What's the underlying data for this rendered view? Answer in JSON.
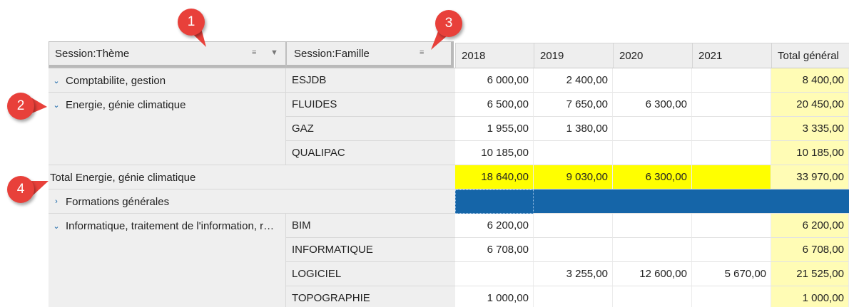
{
  "field_headers": {
    "theme": "Session:Thème",
    "family": "Session:Famille"
  },
  "columns": [
    "2018",
    "2019",
    "2020",
    "2021",
    "Total général"
  ],
  "rows": [
    {
      "theme": "Comptabilite, gestion",
      "family": "ESJDB",
      "values": [
        "6 000,00",
        "2 400,00",
        "",
        ""
      ],
      "total": "8 400,00"
    },
    {
      "theme": "Energie, génie climatique",
      "family": "FLUIDES",
      "values": [
        "6 500,00",
        "7 650,00",
        "6 300,00",
        ""
      ],
      "total": "20 450,00"
    },
    {
      "theme": "",
      "family": "GAZ",
      "values": [
        "1 955,00",
        "1 380,00",
        "",
        ""
      ],
      "total": "3 335,00"
    },
    {
      "theme": "",
      "family": "QUALIPAC",
      "values": [
        "10 185,00",
        "",
        "",
        ""
      ],
      "total": "10 185,00"
    },
    {
      "subtotal_label": "Total Energie, génie climatique",
      "values": [
        "18 640,00",
        "9 030,00",
        "6 300,00",
        ""
      ],
      "total": "33 970,00"
    },
    {
      "theme": "Formations générales"
    },
    {
      "theme": "Informatique, traitement de l'information, r…",
      "family": "BIM",
      "values": [
        "6 200,00",
        "",
        "",
        ""
      ],
      "total": "6 200,00"
    },
    {
      "theme": "",
      "family": "INFORMATIQUE",
      "values": [
        "6 708,00",
        "",
        "",
        ""
      ],
      "total": "6 708,00"
    },
    {
      "theme": "",
      "family": "LOGICIEL",
      "values": [
        "",
        "3 255,00",
        "12 600,00",
        "5 670,00"
      ],
      "total": "21 525,00"
    },
    {
      "theme": "",
      "family": "TOPOGRAPHIE",
      "values": [
        "1 000,00",
        "",
        "",
        ""
      ],
      "total": "1 000,00"
    }
  ],
  "markers": [
    "1",
    "2",
    "3",
    "4"
  ],
  "colors": {
    "accent": "#1565a8",
    "highlight": "#ffff00",
    "total_bg": "#fffcb5",
    "marker": "#e8403a"
  },
  "icons": [
    "sort-icon",
    "filter-icon",
    "chevron-down-icon",
    "chevron-right-icon"
  ]
}
